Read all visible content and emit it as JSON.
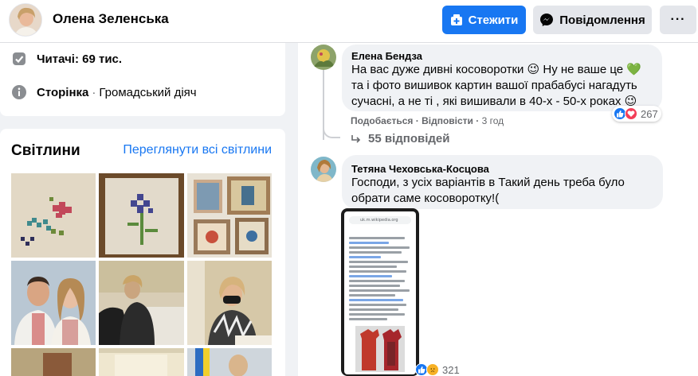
{
  "header": {
    "page_name": "Олена Зеленська",
    "follow_label": "Стежити",
    "message_label": "Повідомлення",
    "more_label": "···"
  },
  "about": {
    "followers_label": "Читачі: 69 тис.",
    "page_label": "Сторінка",
    "page_category": "Громадський діяч"
  },
  "photos": {
    "title": "Світлини",
    "see_all_label": "Переглянути всі світлини"
  },
  "comments": [
    {
      "author": "Елена Бендза",
      "text_lines": [
        "На вас дуже дивні косоворотки 😉 Ну не ваше це 💚",
        "та і фото вишивок картин вашої прабабусі нагадуть",
        "сучасні, а не ті , які вишивали в 40-х - 50-х роках 😉"
      ],
      "like_label": "Подобається",
      "reply_label": "Відповісти",
      "time": "3 год",
      "reaction_count": "267",
      "replies_label": "55 відповідей"
    },
    {
      "author": "Тетяна Чеховська-Косцова",
      "text_lines": [
        "Господи, з усіх варіантів в Такий день треба було",
        "обрати саме косоворотку!("
      ],
      "reaction_count": "321",
      "attachment_url": "uk.m.wikipedia.org"
    }
  ],
  "colors": {
    "accent": "#1877f2",
    "background": "#f0f2f5",
    "muted": "#65676b"
  }
}
